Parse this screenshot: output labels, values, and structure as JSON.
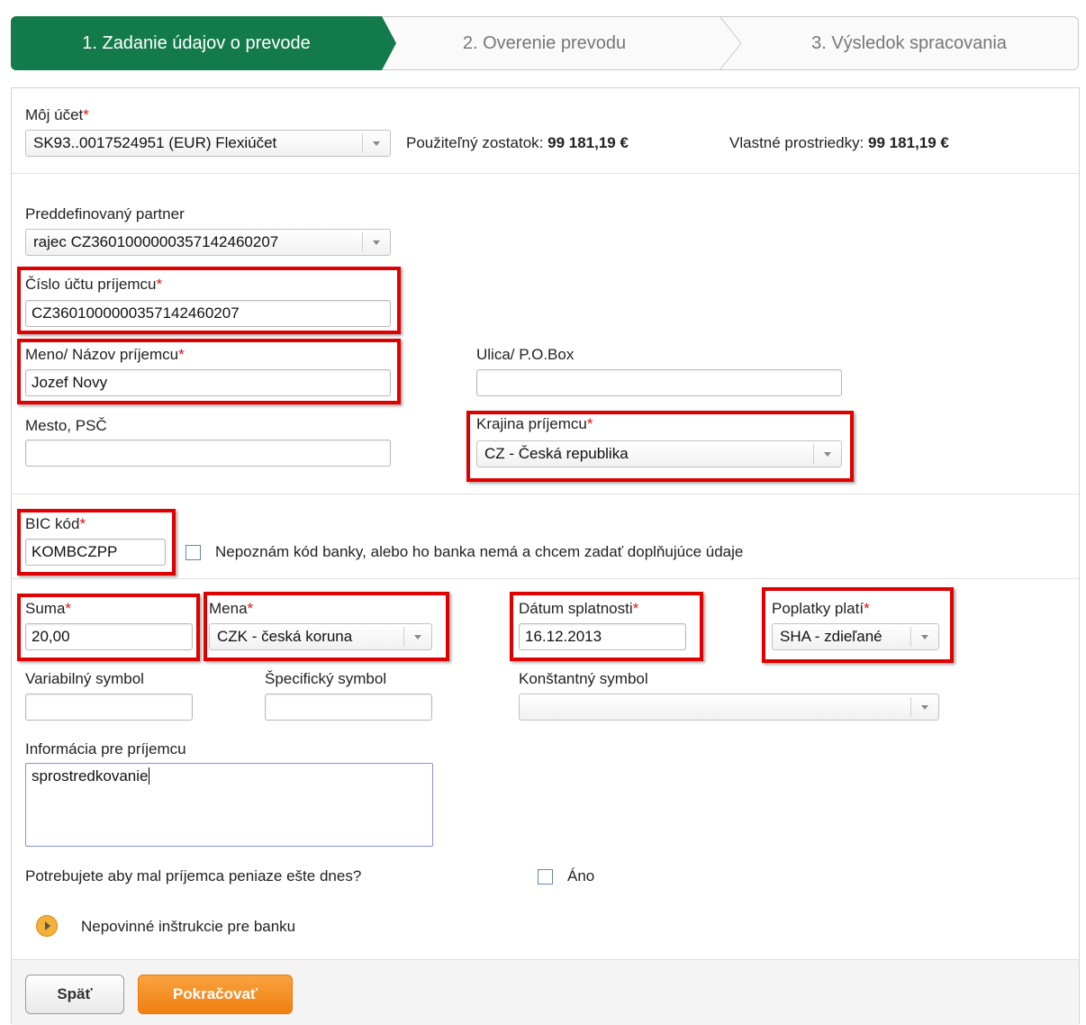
{
  "steps": [
    {
      "label": "1. Zadanie údajov o prevode",
      "active": true
    },
    {
      "label": "2. Overenie prevodu",
      "active": false
    },
    {
      "label": "3. Výsledok spracovania",
      "active": false
    }
  ],
  "colors": {
    "step_active": "#137a4c",
    "required_star": "#e01010",
    "highlight_box": "#e00000",
    "continue_button": "#f07f10"
  },
  "account": {
    "label": "Môj účet",
    "value": "SK93..0017524951 (EUR) Flexiúčet",
    "available_label": "Použiteľný zostatok:",
    "available_value": "99 181,19 €",
    "own_label": "Vlastné prostriedky:",
    "own_value": "99 181,19 €"
  },
  "partner": {
    "label": "Preddefinovaný partner",
    "value": "rajec CZ3601000000357142460207"
  },
  "recipient_account": {
    "label": "Číslo účtu príjemcu",
    "value": "CZ3601000000357142460207"
  },
  "recipient_name": {
    "label": "Meno/ Názov príjemcu",
    "value": "Jozef Novy"
  },
  "street": {
    "label": "Ulica/ P.O.Box",
    "value": ""
  },
  "city": {
    "label": "Mesto, PSČ",
    "value": ""
  },
  "country": {
    "label": "Krajina príjemcu",
    "value": "CZ - Česká republika"
  },
  "bic": {
    "label": "BIC kód",
    "value": "KOMBCZPP",
    "unknown_checkbox_label": "Nepoznám kód banky, alebo ho banka nemá a chcem zadať doplňujúce údaje"
  },
  "amount": {
    "label": "Suma",
    "value": "20,00"
  },
  "currency": {
    "label": "Mena",
    "value": "CZK - česká koruna"
  },
  "due_date": {
    "label": "Dátum splatnosti",
    "value": "16.12.2013"
  },
  "fees": {
    "label": "Poplatky platí",
    "value": "SHA - zdieľané"
  },
  "variable_symbol": {
    "label": "Variabilný symbol",
    "value": ""
  },
  "specific_symbol": {
    "label": "Špecifický symbol",
    "value": ""
  },
  "constant_symbol": {
    "label": "Konštantný symbol",
    "value": ""
  },
  "info": {
    "label": "Informácia pre príjemcu",
    "value": "sprostredkovanie"
  },
  "urgent": {
    "question": "Potrebujete aby mal príjemca peniaze ešte dnes?",
    "checkbox_label": "Áno"
  },
  "instructions": {
    "label": "Nepovinné inštrukcie pre banku"
  },
  "buttons": {
    "back": "Späť",
    "continue": "Pokračovať"
  },
  "required_mark": "*"
}
